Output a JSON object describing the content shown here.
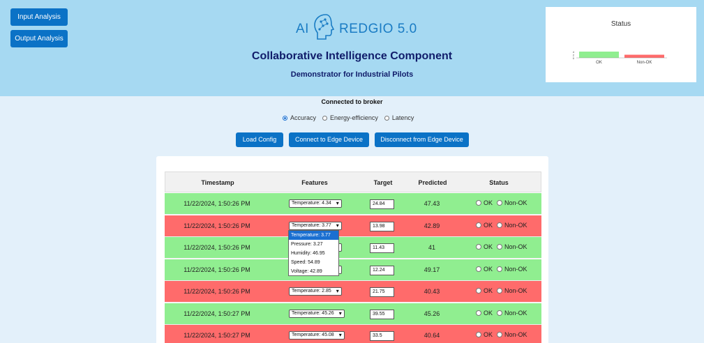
{
  "nav": {
    "input_label": "Input Analysis",
    "output_label": "Output Analysis"
  },
  "logo": {
    "ai": "AI",
    "name": "REDGIO 5.0"
  },
  "header": {
    "title": "Collaborative Intelligence Component",
    "subtitle": "Demonstrator for Industrial Pilots"
  },
  "status_chart": {
    "title": "Status",
    "categories": [
      "OK",
      "Non-OK"
    ],
    "values": [
      4,
      2
    ],
    "colors": [
      "#90ee90",
      "#ff6b6b"
    ],
    "y_ticks": [
      "0",
      "2",
      "4"
    ]
  },
  "broker_status": "Connected to broker",
  "modes": {
    "options": [
      "Accuracy",
      "Energy-efficiency",
      "Latency"
    ],
    "selected": "Accuracy"
  },
  "actions": {
    "load": "Load Config",
    "connect": "Connect to Edge Device",
    "disconnect": "Disconnect from Edge Device"
  },
  "table": {
    "headers": [
      "Timestamp",
      "Features",
      "Target",
      "Predicted",
      "Status"
    ],
    "status_labels": {
      "ok": "OK",
      "nok": "Non-OK"
    },
    "rows": [
      {
        "timestamp": "11/22/2024, 1:50:26 PM",
        "feature": "Temperature: 4.34",
        "target": "24.84",
        "predicted": "47.43",
        "status": "ok"
      },
      {
        "timestamp": "11/22/2024, 1:50:26 PM",
        "feature": "Temperature: 3.77",
        "target": "13.98",
        "predicted": "42.89",
        "status": "nok"
      },
      {
        "timestamp": "11/22/2024, 1:50:26 PM",
        "feature": "Temperature: 3.77",
        "target": "11.43",
        "predicted": "41",
        "status": "ok"
      },
      {
        "timestamp": "11/22/2024, 1:50:26 PM",
        "feature": "Temperature: 3.77",
        "target": "12.24",
        "predicted": "49.17",
        "status": "ok"
      },
      {
        "timestamp": "11/22/2024, 1:50:26 PM",
        "feature": "Temperature: 2.85",
        "target": "21.75",
        "predicted": "40.43",
        "status": "nok"
      },
      {
        "timestamp": "11/22/2024, 1:50:27 PM",
        "feature": "Temperature: 45.26",
        "target": "39.55",
        "predicted": "45.26",
        "status": "ok"
      },
      {
        "timestamp": "11/22/2024, 1:50:27 PM",
        "feature": "Temperature: 45.08",
        "target": "33.5",
        "predicted": "40.64",
        "status": "nok"
      }
    ]
  },
  "dropdown": {
    "items": [
      "Temperature: 3.77",
      "Pressure: 3.27",
      "Humidity: 46.95",
      "Speed: 54.89",
      "Voltage: 42.89"
    ],
    "active": "Temperature: 3.77"
  }
}
